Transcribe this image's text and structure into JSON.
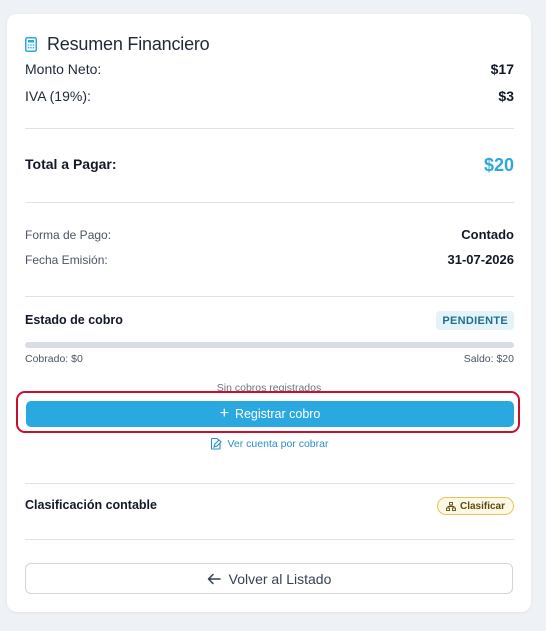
{
  "summary": {
    "title": "Resumen Financiero",
    "title_icon": "calculator-icon",
    "net_label": "Monto Neto:",
    "net_value": "$17",
    "tax_label": "IVA (19%):",
    "tax_value": "$3",
    "total_label": "Total a Pagar:",
    "total_value": "$20",
    "payment_label": "Forma de Pago:",
    "payment_value": "Contado",
    "date_label": "Fecha Emisión:",
    "date_value": "31-07-2026"
  },
  "collection": {
    "label": "Estado de cobro",
    "status": "PENDIENTE",
    "progress_fraction": 0,
    "collected": "Cobrado: $0",
    "balance": "Saldo: $20",
    "no_records": "Sin cobros registrados",
    "register_button": "Registrar cobro",
    "view_link": "Ver cuenta por cobrar"
  },
  "accounting": {
    "label": "Clasificación contable",
    "classify_button": "Clasificar"
  },
  "footer": {
    "back_button": "Volver al Listado"
  },
  "colors": {
    "accent": "#2aa9e0",
    "total": "#2ea7db",
    "focus_ring": "#c8102e",
    "badge_bg": "#e4f3fa",
    "pill_border": "#e7c45a"
  }
}
